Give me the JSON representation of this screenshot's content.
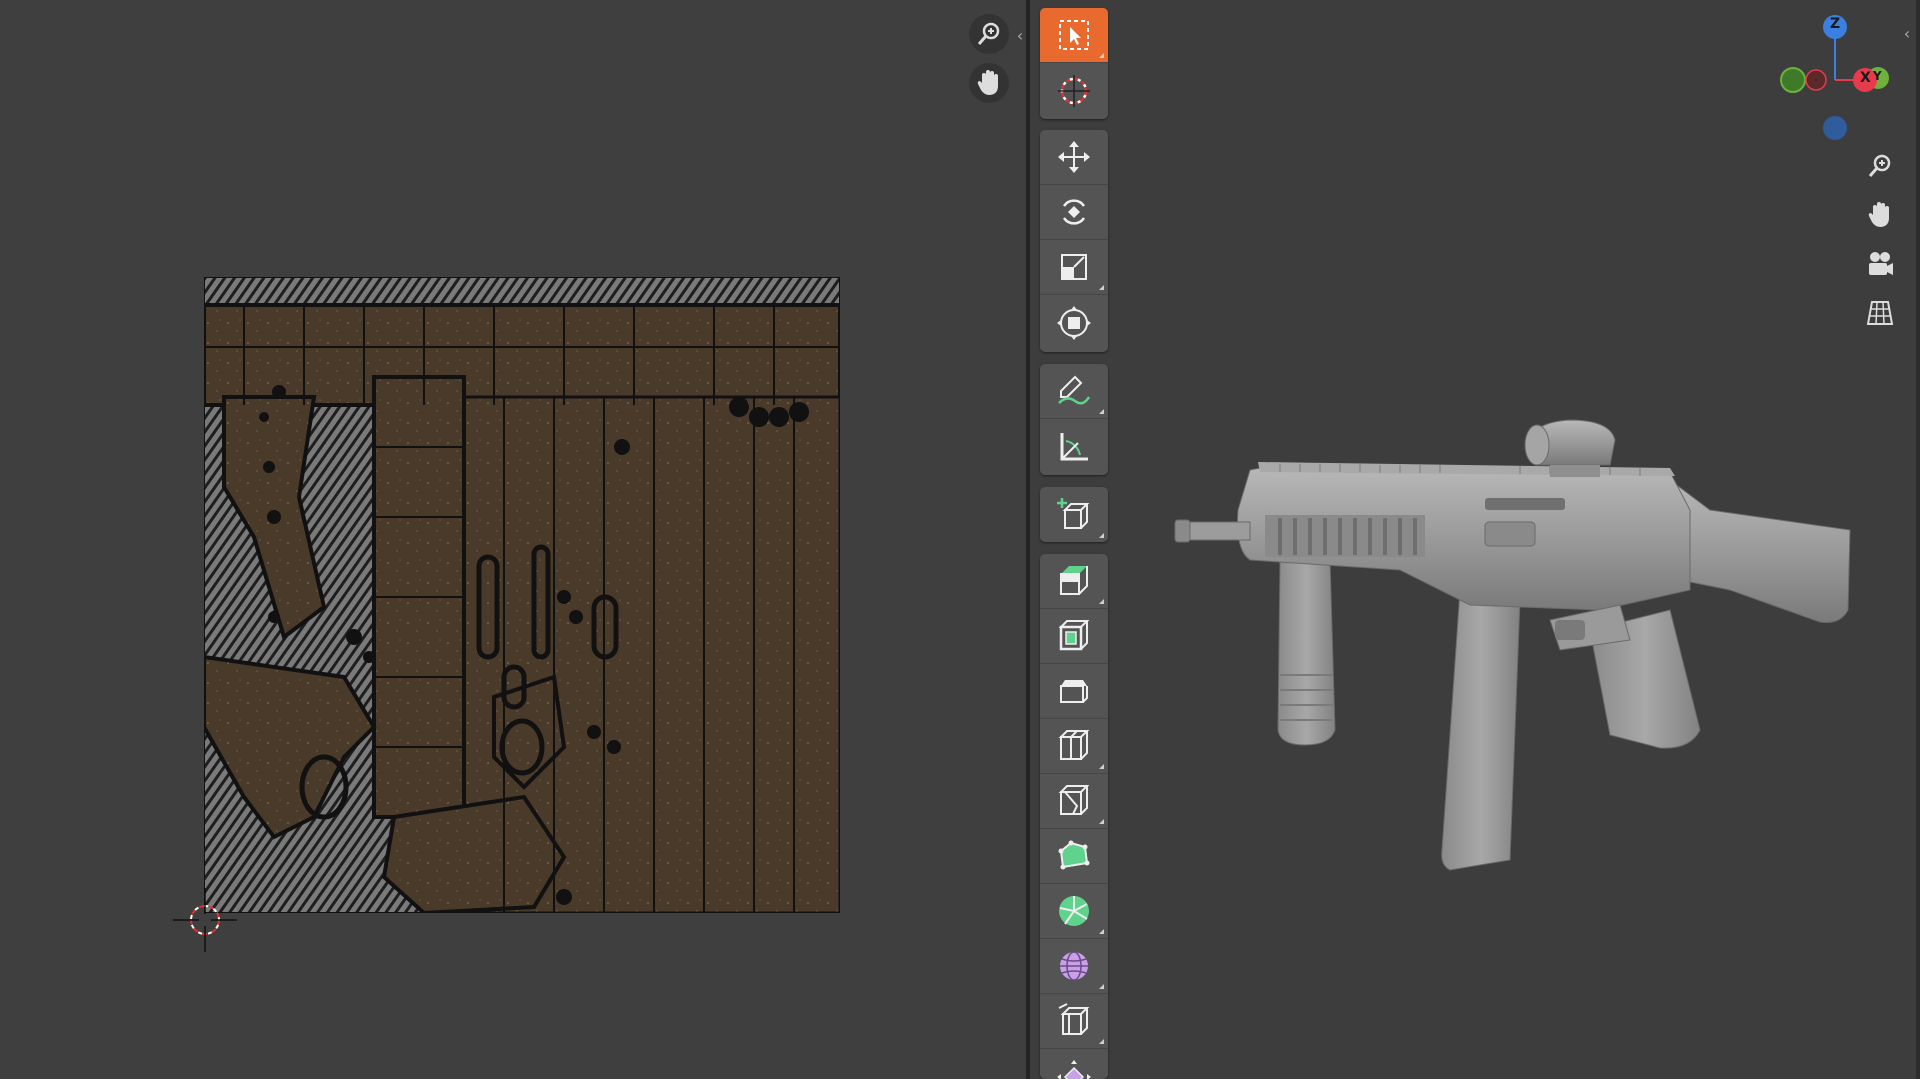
{
  "uv_editor": {
    "collapse_glyph": "‹",
    "nav_icons": [
      "zoom-icon",
      "hand-pan-icon"
    ],
    "texture_color": "#4a3a2a"
  },
  "viewport": {
    "collapse_glyph": "‹",
    "active_tool": "select-box",
    "accent": "#e86a2f",
    "tools": [
      "select-box",
      "cursor",
      "move",
      "rotate",
      "scale",
      "transform",
      "annotate",
      "measure",
      "add-cube",
      "extrude-region",
      "inset-faces",
      "bevel",
      "loop-cut",
      "knife",
      "poly-build",
      "spin",
      "smooth",
      "edge-slide",
      "shrink-fatten"
    ],
    "gizmo": {
      "z_label": "Z",
      "x_label": "X",
      "y_label": "Y",
      "colors": {
        "x": "#e63b4b",
        "y": "#6db23a",
        "z": "#3b7fe0"
      }
    },
    "nav_icons": [
      "zoom-icon",
      "hand-pan-icon",
      "camera-icon",
      "grid-ortho-icon"
    ],
    "model_color": "#9a9a9a"
  }
}
